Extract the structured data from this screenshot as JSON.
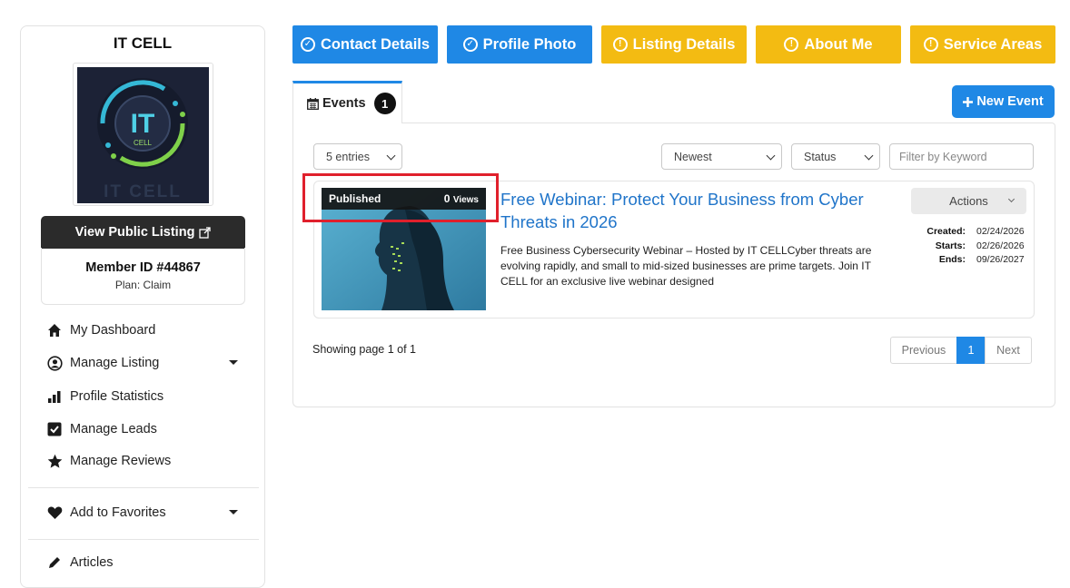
{
  "sidebar": {
    "member_name": "IT CELL",
    "logo_text": "IT",
    "logo_sub": "CELL",
    "logo_caption": "IT CELL",
    "view_public_listing": "View Public Listing",
    "member_id": "Member ID #44867",
    "plan": "Plan: Claim",
    "nav": [
      {
        "label": "My Dashboard",
        "icon": "home-icon"
      },
      {
        "label": "Manage Listing",
        "icon": "user-circle-icon",
        "dropdown": true
      },
      {
        "label": "Profile Statistics",
        "icon": "bar-chart-icon"
      },
      {
        "label": "Manage Leads",
        "icon": "check-square-icon"
      },
      {
        "label": "Manage Reviews",
        "icon": "star-icon"
      },
      {
        "label": "Add to Favorites",
        "icon": "heart-icon",
        "dropdown": true
      },
      {
        "label": "Articles",
        "icon": "edit-icon"
      }
    ]
  },
  "top_buttons": [
    {
      "label": "Contact Details",
      "status": "complete",
      "color": "#1f88e5"
    },
    {
      "label": "Profile Photo",
      "status": "complete",
      "color": "#1f88e5"
    },
    {
      "label": "Listing Details",
      "status": "incomplete",
      "color": "#f3bb12"
    },
    {
      "label": "About Me",
      "status": "incomplete",
      "color": "#f3bb12"
    },
    {
      "label": "Service Areas",
      "status": "incomplete",
      "color": "#f3bb12"
    }
  ],
  "tabs": {
    "events_label": "Events",
    "events_count": "1"
  },
  "new_event_button": "New Event",
  "filters": {
    "entries": "5 entries",
    "sort": "Newest",
    "status": "Status",
    "keyword_placeholder": "Filter by Keyword"
  },
  "event": {
    "status_badge": "Published",
    "views_count": "0",
    "views_label": "Views",
    "title": "Free Webinar: Protect Your Business from Cyber Threats in 2026",
    "description": "Free Business Cybersecurity Webinar – Hosted by IT CELLCyber threats are evolving rapidly, and small to mid-sized businesses are prime targets. Join IT CELL for an exclusive live webinar designed",
    "actions_label": "Actions",
    "created_label": "Created:",
    "created": "02/24/2026",
    "starts_label": "Starts:",
    "starts": "02/26/2026",
    "ends_label": "Ends:",
    "ends": "09/26/2027"
  },
  "pagination": {
    "showing": "Showing page 1 of 1",
    "previous": "Previous",
    "current": "1",
    "next": "Next"
  },
  "colors": {
    "primary_blue": "#1f88e5",
    "warning_yellow": "#f3bb12",
    "highlight_red": "#e0202c",
    "link_blue": "#1f74c9"
  }
}
